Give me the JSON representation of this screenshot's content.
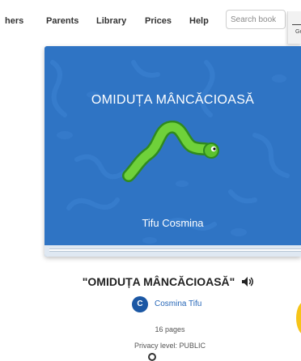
{
  "nav": {
    "items": [
      "hers",
      "Parents",
      "Library",
      "Prices",
      "Help"
    ],
    "search_placeholder": "Search book",
    "panel_label": "Ge"
  },
  "book": {
    "cover_title": "OMIDUȚA MÂNCĂCIOASĂ",
    "cover_author": "Tifu Cosmina",
    "cover_color": "#2f74c4"
  },
  "details": {
    "title": "\"OMIDUȚA MÂNCĂCIOASĂ\"",
    "author_initial": "C",
    "author_name": "Cosmina Tifu",
    "pages": "16 pages",
    "privacy": "Privacy level: PUBLIC"
  },
  "icons": {
    "next": "chevron-right-icon",
    "audio": "speaker-icon"
  }
}
